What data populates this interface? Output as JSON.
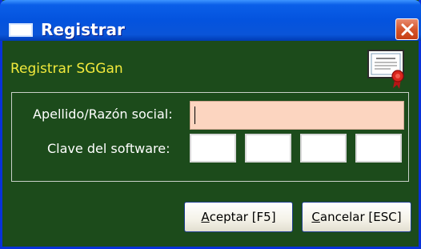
{
  "window": {
    "title": "Registrar",
    "close_glyph": "✕"
  },
  "form": {
    "subtitle": "Registrar SGGan",
    "name_label": "Apellido/Razón social:",
    "name_value": "",
    "key_label": "Clave del software:",
    "key_parts": [
      "",
      "",
      "",
      ""
    ]
  },
  "buttons": {
    "accept_mnemonic": "A",
    "accept_rest": "ceptar [F5]",
    "cancel_mnemonic": "C",
    "cancel_rest": "ancelar [ESC]"
  },
  "icons": {
    "title": "window-icon",
    "certificate": "certificate-icon",
    "close": "close-icon"
  },
  "colors": {
    "background": "#1c4b1b",
    "subtitle": "#f2ea3c",
    "name_input": "#fcd5c0",
    "titlebar": "#0453de"
  }
}
